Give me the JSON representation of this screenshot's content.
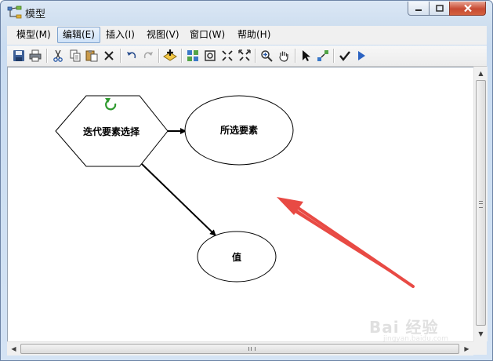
{
  "window": {
    "title": "模型"
  },
  "menu": {
    "items": [
      {
        "label": "模型(M)"
      },
      {
        "label": "编辑(E)"
      },
      {
        "label": "插入(I)"
      },
      {
        "label": "视图(V)"
      },
      {
        "label": "窗口(W)"
      },
      {
        "label": "帮助(H)"
      }
    ],
    "active_index": 1
  },
  "toolbar": {
    "icons": [
      "save-icon",
      "print-icon",
      "cut-icon",
      "copy-icon",
      "paste-icon",
      "delete-icon",
      "undo-icon",
      "redo-icon",
      "add-data-icon",
      "auto-layout-icon",
      "full-extent-icon",
      "zoom-in-fixed-icon",
      "zoom-out-fixed-icon",
      "zoom-in-icon",
      "pan-icon",
      "select-icon",
      "connect-icon",
      "validate-icon",
      "run-icon"
    ]
  },
  "diagram": {
    "iterator_node": {
      "label": "迭代要素选择",
      "icon": "iterate-loop-icon"
    },
    "output_node": {
      "label": "所选要素"
    },
    "value_node": {
      "label": "值"
    },
    "annotation_color": "#e84a44"
  },
  "watermark": {
    "text": "Bai 经验",
    "sub": "jingyan.baidu.com"
  }
}
